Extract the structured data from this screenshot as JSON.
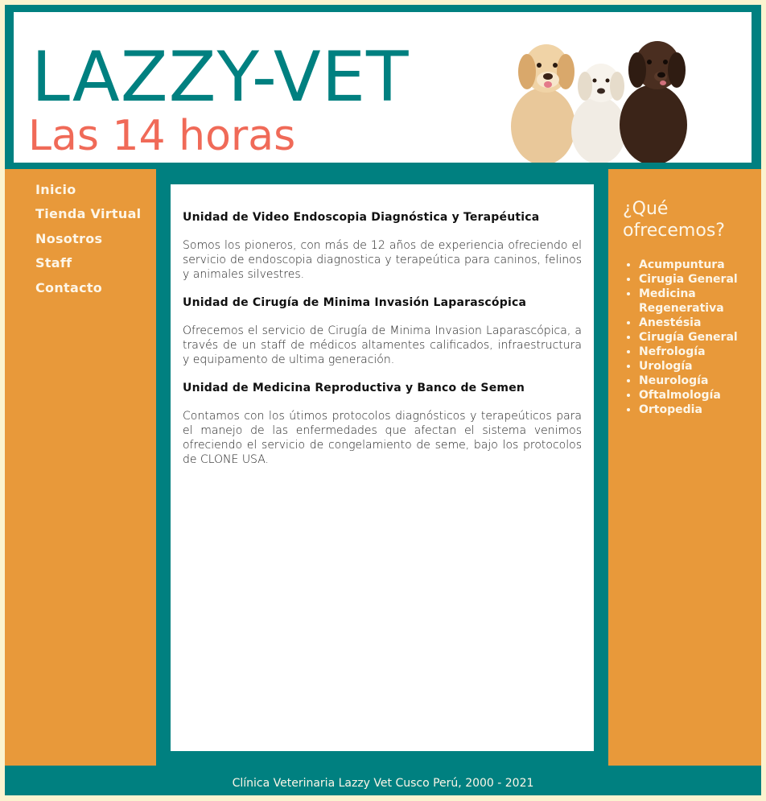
{
  "header": {
    "title": "LAZZY-VET",
    "subtitle": "Las 14 horas"
  },
  "nav": {
    "items": [
      "Inicio",
      "Tienda Virtual",
      "Nosotros",
      "Staff",
      "Contacto"
    ]
  },
  "main": {
    "sections": [
      {
        "heading": "Unidad de Video Endoscopia Diagnóstica y Terapéutica",
        "body": "Somos los pioneros, con más de 12 años de experiencia ofreciendo el servicio de endoscopia diagnostica y terapeútica para caninos, felinos y animales silvestres."
      },
      {
        "heading": "Unidad de Cirugía de Minima Invasión Laparascópica",
        "body": "Ofrecemos el servicio de Cirugía de Minima Invasion Laparascópica, a través de un staff de médicos altamentes calificados, infraestructura y equipamento de ultima generación."
      },
      {
        "heading": "Unidad de Medicina Reproductiva y Banco de Semen",
        "body": "Contamos con los útimos protocolos diagnósticos y terapeúticos para el manejo de las enfermedades que afectan el sistema venimos ofreciendo el servicio de congelamiento de seme, bajo los protocolos de CLONE USA."
      }
    ]
  },
  "sidebar": {
    "title": "¿Qué ofrecemos?",
    "services": [
      "Acumpuntura",
      "Cirugia General",
      "Medicina Regenerativa",
      "Anestésia",
      "Cirugía General",
      "Nefrología",
      "Urología",
      "Neurología",
      "Oftalmología",
      "Ortopedia"
    ]
  },
  "footer": {
    "text": "Clínica Veterinaria Lazzy Vet Cusco Perú, 2000 - 2021"
  },
  "colors": {
    "teal": "#008080",
    "orange": "#e8993a",
    "salmon": "#f06a58",
    "cream": "#fbf3cf"
  }
}
